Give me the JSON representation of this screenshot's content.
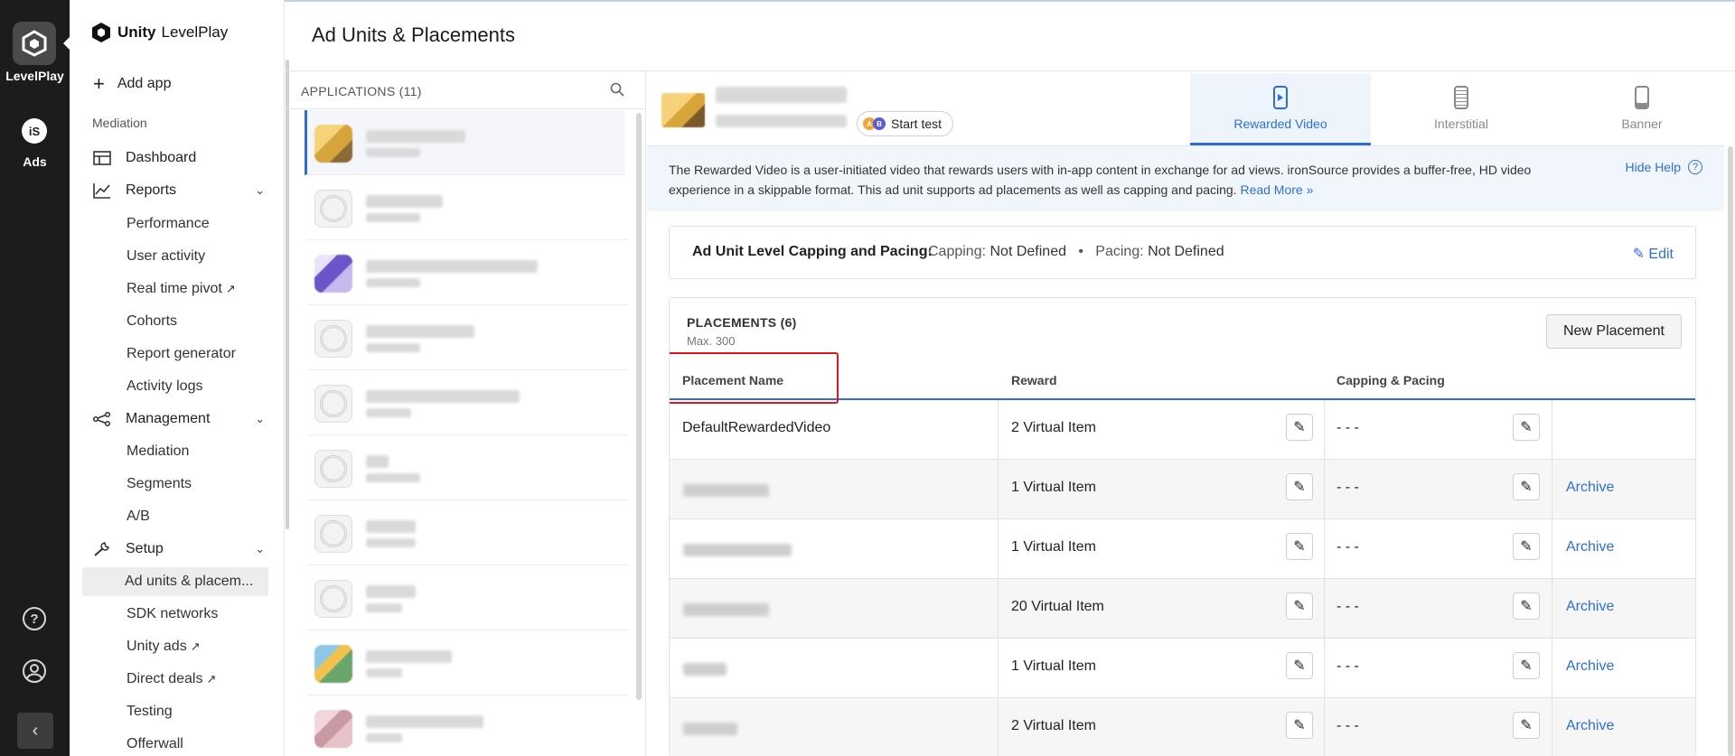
{
  "rail": {
    "app_label": "LevelPlay",
    "ads_label": "Ads",
    "ads_icon_text": "iS",
    "help_icon": "question-circle-icon",
    "user_icon": "user-circle-icon",
    "collapse_icon": "chevron-left-icon",
    "collapse_glyph": "‹"
  },
  "sidebar": {
    "logo_brand": "Unity",
    "logo_product": "LevelPlay",
    "add_app": "Add app",
    "section_mediation": "Mediation",
    "items": {
      "dashboard": "Dashboard",
      "reports": "Reports",
      "management": "Management",
      "setup": "Setup"
    },
    "reports_sub": [
      "Performance",
      "User activity",
      "Real time pivot",
      "Cohorts",
      "Report generator",
      "Activity logs"
    ],
    "management_sub": [
      "Mediation",
      "Segments",
      "A/B"
    ],
    "setup_sub": [
      "Ad units & placem...",
      "SDK networks",
      "Unity ads",
      "Direct deals",
      "Testing",
      "Offerwall"
    ],
    "active_item": "Ad units & placem..."
  },
  "header": {
    "title": "Ad Units & Placements"
  },
  "apps_panel": {
    "header": "APPLICATIONS (11)",
    "search_icon": "search-icon"
  },
  "app_header": {
    "start_test": "Start test",
    "ab_a": "A",
    "ab_b": "B"
  },
  "tabs": [
    {
      "label": "Rewarded Video",
      "active": true
    },
    {
      "label": "Interstitial",
      "active": false
    },
    {
      "label": "Banner",
      "active": false
    }
  ],
  "info": {
    "text": "The Rewarded Video is a user-initiated video that rewards users with in-app content in exchange for ad views. ironSource provides a buffer-free, HD video experience in a skippable format. This ad unit supports ad placements as well as capping and pacing.",
    "read_more": "Read More »",
    "hide_help": "Hide Help"
  },
  "capping": {
    "title": "Ad Unit Level Capping and Pacing:",
    "capping_label": "Capping:",
    "capping_value": "Not Defined",
    "separator": "•",
    "pacing_label": "Pacing:",
    "pacing_value": "Not Defined",
    "edit": "Edit"
  },
  "placements": {
    "title": "PLACEMENTS (6)",
    "max": "Max. 300",
    "new_button": "New Placement",
    "columns": [
      "Placement Name",
      "Reward",
      "Capping & Pacing"
    ],
    "rows": [
      {
        "name": "DefaultRewardedVideo",
        "reward": "2 Virtual Item",
        "capping": "- - -",
        "archive": ""
      },
      {
        "name": "",
        "reward": "1 Virtual Item",
        "capping": "- - -",
        "archive": "Archive"
      },
      {
        "name": "",
        "reward": "1 Virtual Item",
        "capping": "- - -",
        "archive": "Archive"
      },
      {
        "name": "",
        "reward": "20 Virtual Item",
        "capping": "- - -",
        "archive": "Archive"
      },
      {
        "name": "",
        "reward": "1 Virtual Item",
        "capping": "- - -",
        "archive": "Archive"
      },
      {
        "name": "",
        "reward": "2 Virtual Item",
        "capping": "- - -",
        "archive": "Archive"
      }
    ]
  },
  "colors": {
    "accent": "#2d6fd6",
    "rail": "#1c1c1c",
    "highlight": "#e0161b"
  }
}
